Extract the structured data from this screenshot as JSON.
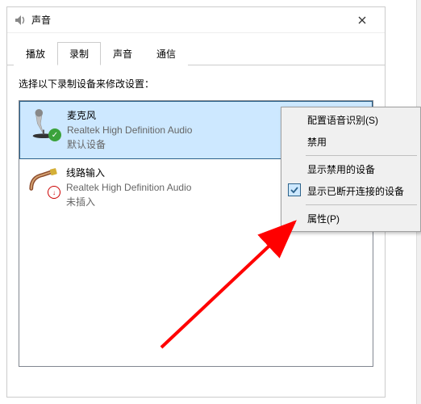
{
  "window": {
    "title": "声音",
    "icon_name": "sound-icon"
  },
  "tabs": {
    "items": [
      {
        "label": "播放",
        "active": false
      },
      {
        "label": "录制",
        "active": true
      },
      {
        "label": "声音",
        "active": false
      },
      {
        "label": "通信",
        "active": false
      }
    ]
  },
  "instruction": "选择以下录制设备来修改设置：",
  "devices": [
    {
      "name": "麦克风",
      "description": "Realtek High Definition Audio",
      "status": "默认设备",
      "selected": true,
      "status_type": "default",
      "icon": "microphone"
    },
    {
      "name": "线路输入",
      "description": "Realtek High Definition Audio",
      "status": "未插入",
      "selected": false,
      "status_type": "unplugged",
      "icon": "line-in"
    }
  ],
  "context_menu": {
    "items": [
      {
        "label": "配置语音识别(S)",
        "checked": false
      },
      {
        "label": "禁用",
        "checked": false
      },
      {
        "sep": true
      },
      {
        "label": "显示禁用的设备",
        "checked": false
      },
      {
        "label": "显示已断开连接的设备",
        "checked": true
      },
      {
        "sep": true
      },
      {
        "label": "属性(P)",
        "checked": false
      }
    ]
  }
}
